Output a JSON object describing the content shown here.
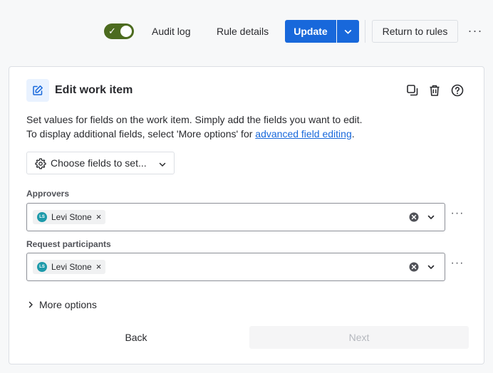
{
  "topbar": {
    "toggle_enabled": true,
    "audit_log_label": "Audit log",
    "rule_details_label": "Rule details",
    "update_label": "Update",
    "return_label": "Return to rules",
    "more_label": "···"
  },
  "card": {
    "title": "Edit work item",
    "icons": [
      "edit-icon",
      "copy-icon",
      "trash-icon",
      "help-icon"
    ],
    "description_line1": "Set values for fields on the work item. Simply add the fields you want to edit.",
    "description_line2_prefix": "To display additional fields, select 'More options' for ",
    "description_link": "advanced field editing",
    "description_line2_suffix": ".",
    "choose_fields_label": "Choose fields to set...",
    "fields": [
      {
        "label": "Approvers",
        "chip_initials": "LS",
        "chip_name": "Levi Stone",
        "chip_remove": "×",
        "more": "···"
      },
      {
        "label": "Request participants",
        "chip_initials": "LS",
        "chip_name": "Levi Stone",
        "chip_remove": "×",
        "more": "···"
      }
    ],
    "more_options_label": "More options",
    "back_label": "Back",
    "next_label": "Next"
  },
  "colors": {
    "primary": "#1868db",
    "toggle_on": "#4c6b1f",
    "avatar": "#1d9aaa",
    "link": "#1868db"
  }
}
